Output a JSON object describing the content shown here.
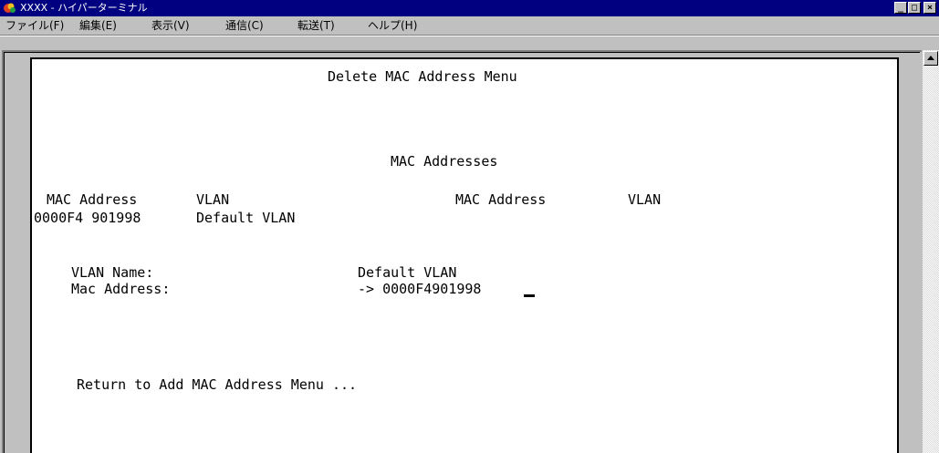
{
  "window": {
    "title": "XXXX - ハイパーターミナル",
    "app_icon": "hyperterminal-icon",
    "controls": {
      "minimize": "_",
      "maximize": "□",
      "close": "×"
    }
  },
  "menubar": {
    "items": [
      {
        "label": "ファイル(F)"
      },
      {
        "label": "編集(E)"
      },
      {
        "label": "表示(V)"
      },
      {
        "label": "通信(C)"
      },
      {
        "label": "転送(T)"
      },
      {
        "label": "ヘルプ(H)"
      }
    ]
  },
  "terminal": {
    "menu_title": "Delete MAC Address Menu",
    "section_title": "MAC Addresses",
    "table": {
      "headers": [
        "MAC Address",
        "VLAN",
        "MAC Address",
        "VLAN"
      ],
      "rows": [
        {
          "mac": "0000F4 901998",
          "vlan": "Default VLAN"
        }
      ]
    },
    "fields": {
      "vlan_name_label": "VLAN Name:",
      "vlan_name_value": "Default VLAN",
      "mac_label": "Mac Address:",
      "mac_value": "-> 0000F4901998"
    },
    "return_option": "Return to Add MAC Address Menu ..."
  },
  "colors": {
    "titlebar": "#000080",
    "terminal_bg": "#ffffff",
    "chrome": "#c0c0c0"
  }
}
